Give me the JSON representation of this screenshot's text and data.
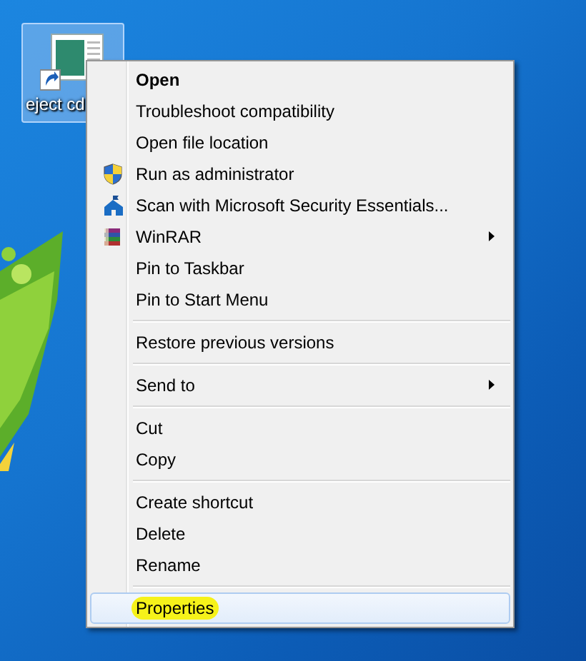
{
  "desktop_icon": {
    "label": "eject cd",
    "selected": true
  },
  "context_menu": {
    "items": [
      {
        "kind": "item",
        "label": "Open",
        "bold": true,
        "submenu": false,
        "selected": false,
        "highlighted": false
      },
      {
        "kind": "item",
        "label": "Troubleshoot compatibility",
        "bold": false,
        "submenu": false,
        "selected": false,
        "highlighted": false
      },
      {
        "kind": "item",
        "label": "Open file location",
        "bold": false,
        "submenu": false,
        "selected": false,
        "highlighted": false
      },
      {
        "kind": "shield",
        "label": "Run as administrator",
        "bold": false,
        "submenu": false,
        "selected": false,
        "highlighted": false
      },
      {
        "kind": "house",
        "label": "Scan with Microsoft Security Essentials...",
        "bold": false,
        "submenu": false,
        "selected": false,
        "highlighted": false
      },
      {
        "kind": "books",
        "label": "WinRAR",
        "bold": false,
        "submenu": true,
        "selected": false,
        "highlighted": false
      },
      {
        "kind": "item",
        "label": "Pin to Taskbar",
        "bold": false,
        "submenu": false,
        "selected": false,
        "highlighted": false
      },
      {
        "kind": "item",
        "label": "Pin to Start Menu",
        "bold": false,
        "submenu": false,
        "selected": false,
        "highlighted": false
      },
      {
        "kind": "separator"
      },
      {
        "kind": "item",
        "label": "Restore previous versions",
        "bold": false,
        "submenu": false,
        "selected": false,
        "highlighted": false
      },
      {
        "kind": "separator"
      },
      {
        "kind": "item",
        "label": "Send to",
        "bold": false,
        "submenu": true,
        "selected": false,
        "highlighted": false
      },
      {
        "kind": "separator"
      },
      {
        "kind": "item",
        "label": "Cut",
        "bold": false,
        "submenu": false,
        "selected": false,
        "highlighted": false
      },
      {
        "kind": "item",
        "label": "Copy",
        "bold": false,
        "submenu": false,
        "selected": false,
        "highlighted": false
      },
      {
        "kind": "separator"
      },
      {
        "kind": "item",
        "label": "Create shortcut",
        "bold": false,
        "submenu": false,
        "selected": false,
        "highlighted": false
      },
      {
        "kind": "item",
        "label": "Delete",
        "bold": false,
        "submenu": false,
        "selected": false,
        "highlighted": false
      },
      {
        "kind": "item",
        "label": "Rename",
        "bold": false,
        "submenu": false,
        "selected": false,
        "highlighted": false
      },
      {
        "kind": "separator"
      },
      {
        "kind": "item",
        "label": "Properties",
        "bold": false,
        "submenu": false,
        "selected": true,
        "highlighted": true
      }
    ]
  }
}
